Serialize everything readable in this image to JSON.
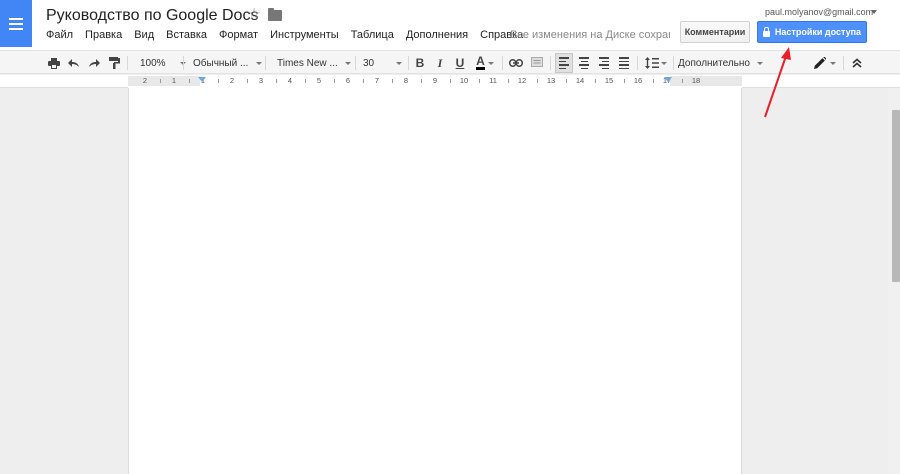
{
  "header": {
    "title": "Руководство по Google Docs",
    "star_icon": "star-icon",
    "folder_icon": "folder-icon",
    "user_email": "paul.molyanov@gmail.com",
    "comments_label": "Комментарии",
    "share_label": "Настройки доступа",
    "save_status": "Все изменения на Диске сохран..."
  },
  "menu": {
    "items": [
      "Файл",
      "Правка",
      "Вид",
      "Вставка",
      "Формат",
      "Инструменты",
      "Таблица",
      "Дополнения",
      "Справка"
    ]
  },
  "toolbar": {
    "zoom": "100%",
    "style": "Обычный ...",
    "font": "Times New ...",
    "size": "30",
    "bold": "B",
    "italic": "I",
    "underline": "U",
    "text_color": "A",
    "more": "Дополнительно"
  },
  "ruler": {
    "labels": [
      "2",
      "1",
      "1",
      "2",
      "3",
      "4",
      "5",
      "6",
      "7",
      "8",
      "9",
      "10",
      "11",
      "12",
      "13",
      "14",
      "15",
      "16",
      "17",
      "18"
    ]
  },
  "colors": {
    "brand": "#4285f4",
    "share_button": "#4d90fe",
    "annotation_arrow": "#e8202a"
  }
}
